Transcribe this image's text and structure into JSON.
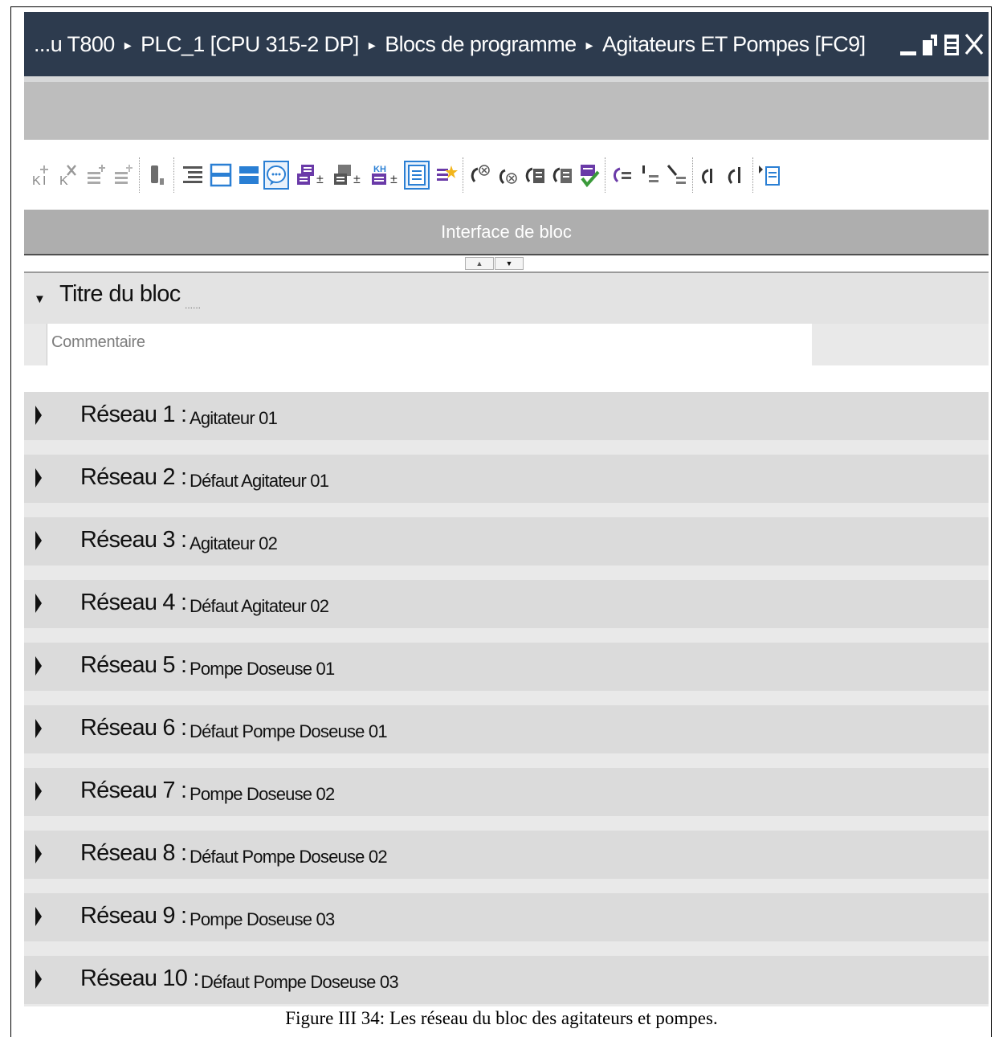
{
  "titlebar": {
    "breadcrumb": [
      "...u T800",
      "PLC_1 [CPU 315-2 DP]",
      "Blocs de programme",
      "Agitateurs ET Pompes [FC9]"
    ],
    "separator": "▸"
  },
  "toolbar": {
    "icons": [
      "insert-network-icon",
      "delete-network-icon",
      "insert-row-icon",
      "add-row-icon",
      "insert-empty-box-icon",
      "open-all-networks-icon",
      "network-overview-icon",
      "close-all-networks-icon",
      "comments-toggle-icon",
      "absolute-operands-icon",
      "show-symbolic-icon",
      "symbol-information-icon",
      "network-comments-icon",
      "favorites-icon",
      "go-to-previous-error-icon",
      "go-to-next-error-icon",
      "update-calls-icon",
      "update-block-icon",
      "check-block-icon",
      "monitoring-icon",
      "step-in-icon",
      "step-out-icon",
      "previous-call-icon",
      "next-call-icon",
      "more-icon"
    ]
  },
  "interface": {
    "label": "Interface de bloc"
  },
  "block": {
    "title": "Titre du bloc",
    "title_dots": "......",
    "comment_placeholder": "Commentaire"
  },
  "networks": [
    {
      "label": "Réseau 1 :",
      "desc": "Agitateur 01"
    },
    {
      "label": "Réseau 2 :",
      "desc": "Défaut Agitateur 01"
    },
    {
      "label": "Réseau 3 :",
      "desc": "Agitateur 02"
    },
    {
      "label": "Réseau 4 :",
      "desc": "Défaut Agitateur 02"
    },
    {
      "label": "Réseau 5 :",
      "desc": "Pompe Doseuse 01"
    },
    {
      "label": "Réseau 6 :",
      "desc": "Défaut Pompe Doseuse 01"
    },
    {
      "label": "Réseau 7 :",
      "desc": "Pompe Doseuse 02"
    },
    {
      "label": "Réseau 8 :",
      "desc": "Défaut Pompe Doseuse 02"
    },
    {
      "label": "Réseau 9 :",
      "desc": "Pompe Doseuse 03"
    },
    {
      "label": "Réseau 10 :",
      "desc": "Défaut Pompe Doseuse 03"
    }
  ],
  "caption": "Figure III 34: Les réseau du bloc des agitateurs et pompes.",
  "colors": {
    "titlebar": "#2d3b4e",
    "accent": "#2a7fd4",
    "icon_purple": "#6a3aa8",
    "icon_green": "#3a9a3a"
  }
}
